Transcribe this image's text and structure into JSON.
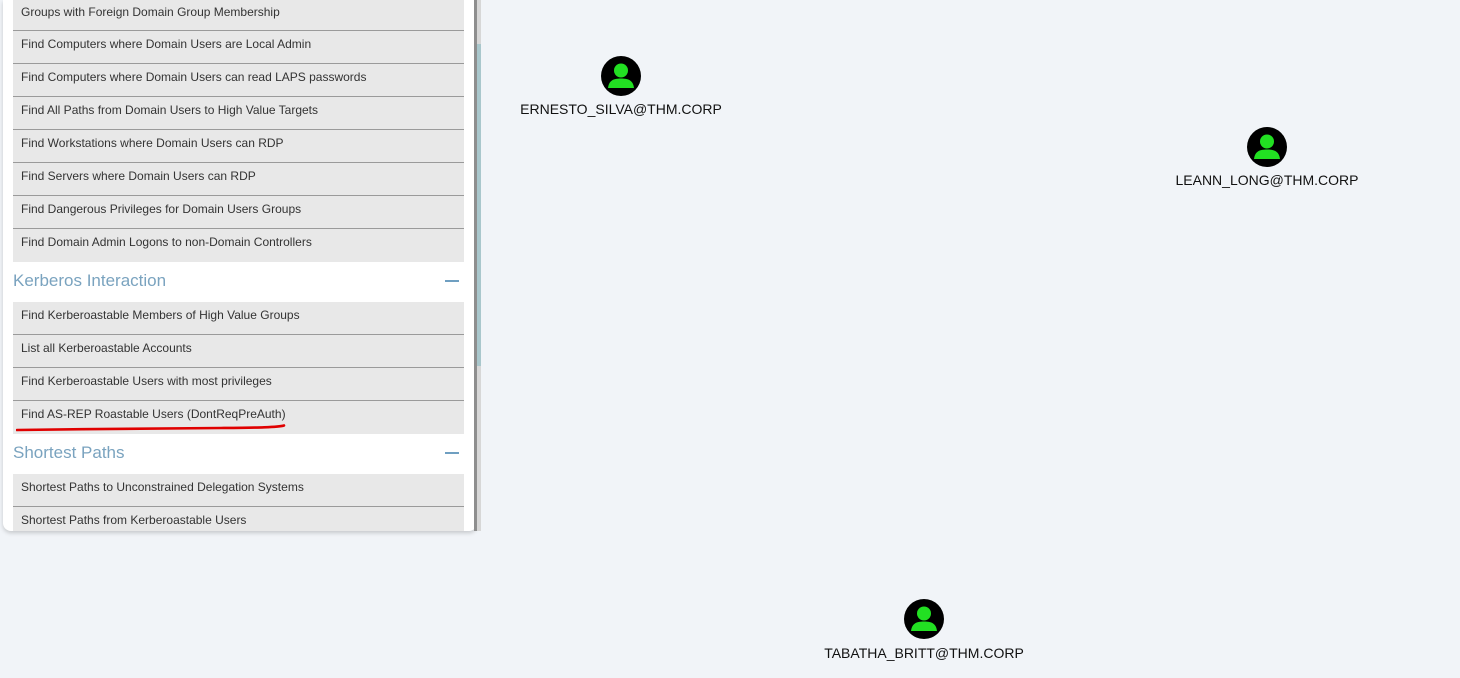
{
  "colors": {
    "background": "#f1f4f8",
    "section_title": "#7aa3bf",
    "query_bg": "#e8e8e8",
    "node_icon_fill": "#000000",
    "node_user": "#22e022",
    "annotation": "#e00000"
  },
  "queries_top": [
    {
      "label": "Groups with Foreign Domain Group Membership"
    },
    {
      "label": "Find Computers where Domain Users are Local Admin"
    },
    {
      "label": "Find Computers where Domain Users can read LAPS passwords"
    },
    {
      "label": "Find All Paths from Domain Users to High Value Targets"
    },
    {
      "label": "Find Workstations where Domain Users can RDP"
    },
    {
      "label": "Find Servers where Domain Users can RDP"
    },
    {
      "label": "Find Dangerous Privileges for Domain Users Groups"
    },
    {
      "label": "Find Domain Admin Logons to non-Domain Controllers"
    }
  ],
  "sections": {
    "kerberos": {
      "title": "Kerberos Interaction",
      "collapse_icon": "minus-icon",
      "items": [
        {
          "label": "Find Kerberoastable Members of High Value Groups"
        },
        {
          "label": "List all Kerberoastable Accounts"
        },
        {
          "label": "Find Kerberoastable Users with most privileges"
        },
        {
          "label": "Find AS-REP Roastable Users (DontReqPreAuth)"
        }
      ]
    },
    "shortest": {
      "title": "Shortest Paths",
      "collapse_icon": "minus-icon",
      "items": [
        {
          "label": "Shortest Paths to Unconstrained Delegation Systems"
        },
        {
          "label": "Shortest Paths from Kerberoastable Users"
        }
      ]
    }
  },
  "graph": {
    "nodes": [
      {
        "label": "ERNESTO_SILVA@THM.CORP",
        "icon": "user-icon"
      },
      {
        "label": "LEANN_LONG@THM.CORP",
        "icon": "user-icon"
      },
      {
        "label": "TABATHA_BRITT@THM.CORP",
        "icon": "user-icon"
      }
    ]
  }
}
